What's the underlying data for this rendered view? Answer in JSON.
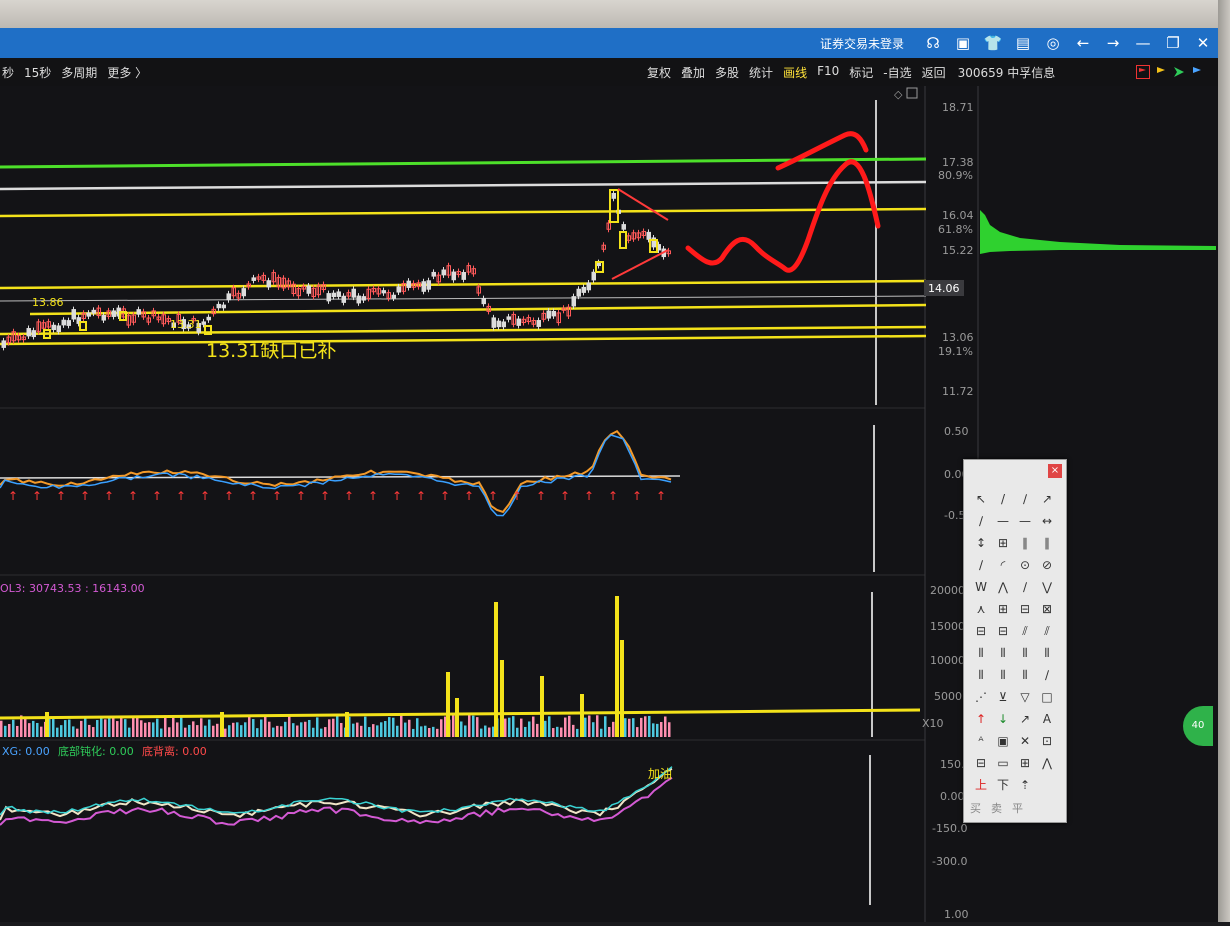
{
  "titlebar": {
    "status": "证券交易未登录",
    "icons": [
      "headset-icon",
      "layout-icon",
      "shirt-icon",
      "document-icon",
      "settings-icon",
      "back-arrow-icon",
      "forward-arrow-icon",
      "minimize-icon",
      "restore-icon",
      "close-icon"
    ],
    "glyphs": [
      "☊",
      "▣",
      "👕",
      "▤",
      "◎",
      "←",
      "→",
      "—",
      "❐",
      "✕"
    ]
  },
  "menubar": {
    "left": [
      "秒",
      "15秒",
      "多周期",
      "更多 〉"
    ],
    "right": [
      "复权",
      "叠加",
      "多股",
      "统计",
      "画线",
      "F10",
      "标记",
      "-自选",
      "返回"
    ],
    "active": "画线",
    "ticker": "300659 中孚信息"
  },
  "price_axis": [
    "18.71",
    "17.38",
    "80.9%",
    "16.04",
    "61.8%",
    "15.22",
    "14.06",
    "13.06",
    "19.1%",
    "11.72"
  ],
  "current_price": "14.06",
  "labels": {
    "level_1386": "13.86",
    "level_1331": "13.31",
    "gap_note": "13.31缺口已补"
  },
  "macd_axis": [
    "0.50",
    "0.00",
    "-0.50"
  ],
  "volume_header": "OL3: 30743.53 : 16143.00",
  "volume_axis": [
    "20000",
    "15000",
    "10000",
    "5000",
    "X10"
  ],
  "bottom_header": {
    "xg": "XG: 0.00",
    "a_label": "底部钝化: 0.00",
    "b_label": "底背离: 0.00"
  },
  "bottom_axis": [
    "150.0",
    "0.00",
    "-150.0",
    "-300.0",
    "1.00"
  ],
  "bottom_tags": [
    "加油"
  ],
  "toolbox": {
    "close": "×",
    "tools": [
      "↖",
      "/",
      "∕",
      "↗",
      "∕",
      "—",
      "—",
      "↔",
      "↕",
      "⊞",
      "∥",
      "∥",
      "∕",
      "◜",
      "⊙",
      "⊘",
      "W",
      "⋀",
      "∕",
      "⋁",
      "⋏",
      "⊞",
      "⊟",
      "⊠",
      "⊟",
      "⊟",
      "⫽",
      "⫽",
      "⦀",
      "⦀",
      "⦀",
      "⦀",
      "⦀",
      "⦀",
      "⦀",
      "∕",
      "⋰",
      "⊻",
      "▽",
      "□",
      "↑",
      "↓",
      "↗",
      "A",
      "ᴬ",
      "▣",
      "✕",
      "⊡",
      "⊟",
      "▭",
      "⊞",
      "⋀",
      "上",
      "下",
      "⇡",
      ""
    ],
    "footer": [
      "买",
      "卖",
      "平"
    ]
  },
  "badge": "40",
  "colors": {
    "green_line": "#4de02a",
    "white_line": "#dcdcdc",
    "yellow_line": "#f3e21a",
    "red_pen": "#ff1a1a",
    "title_blue": "#1f6fc6"
  }
}
